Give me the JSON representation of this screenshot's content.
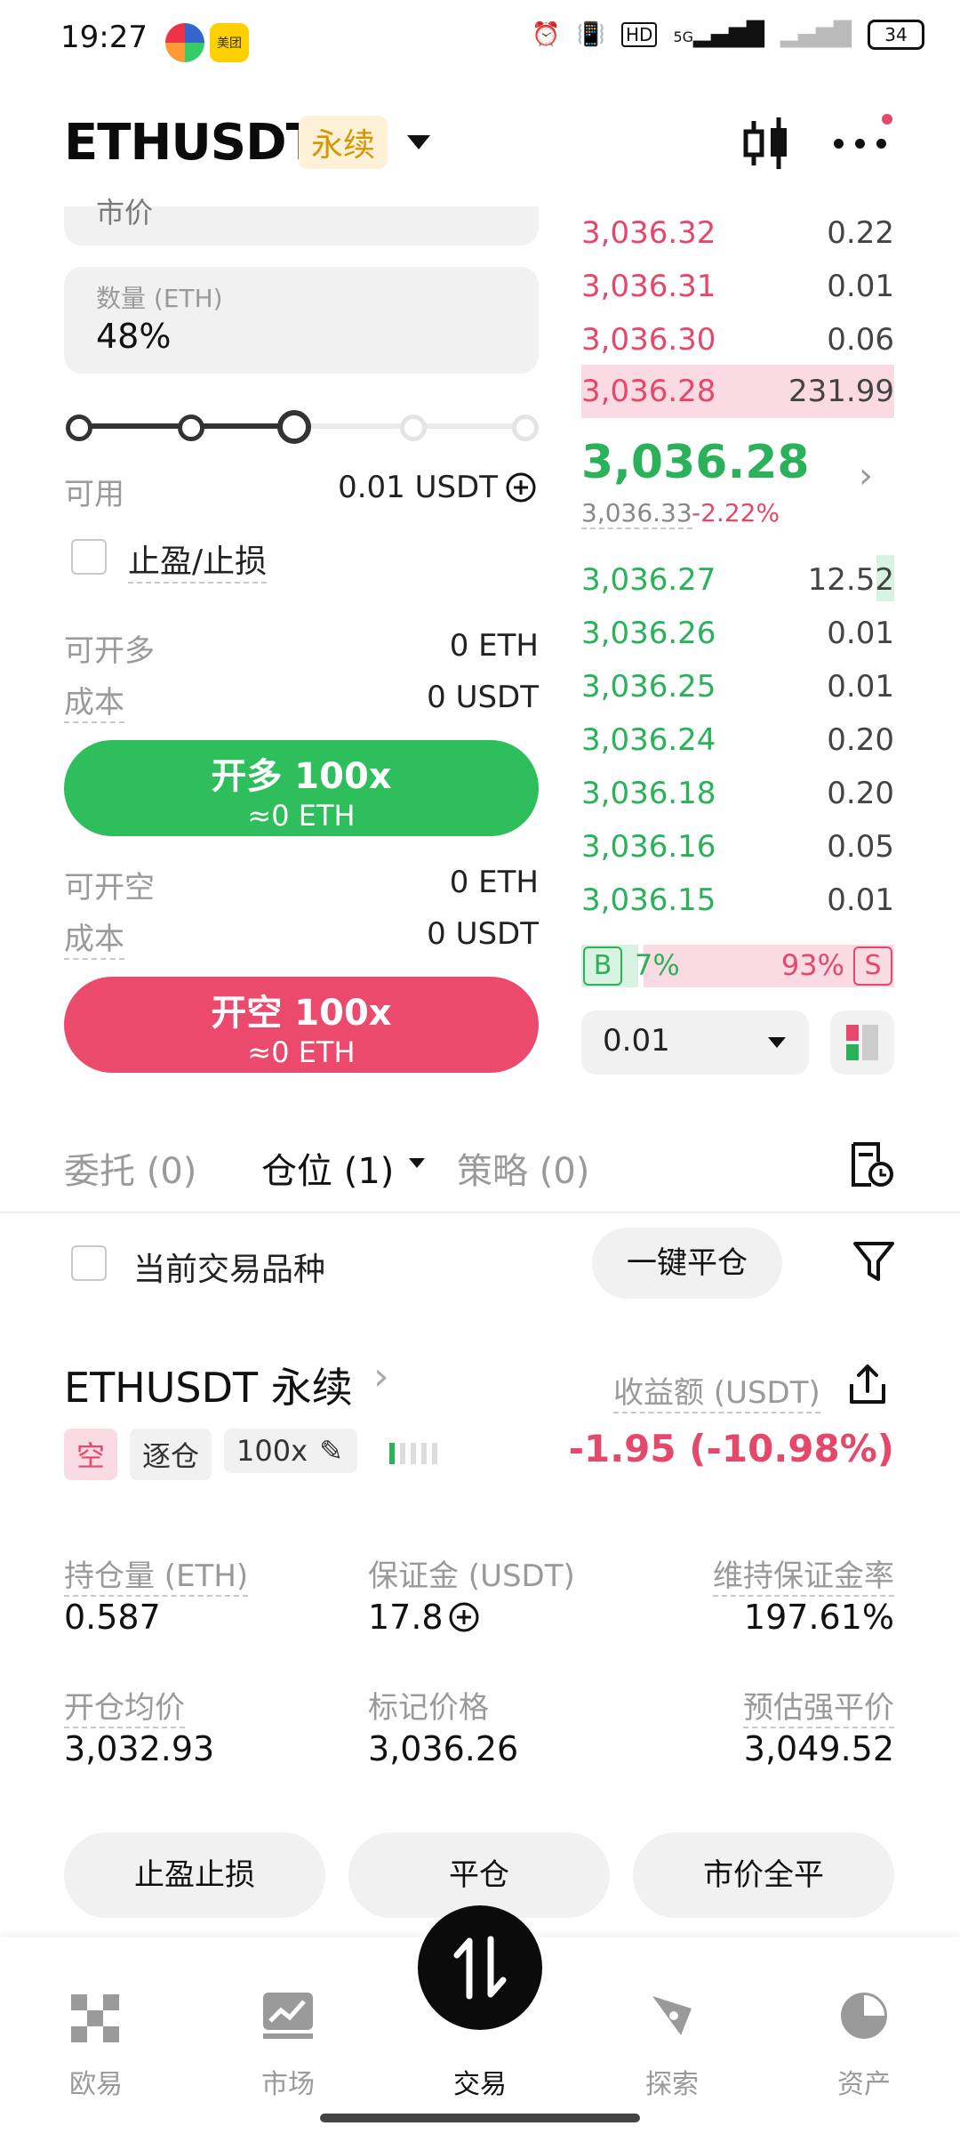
{
  "status_bar": {
    "time": "19:27",
    "network": "5G",
    "battery": "34"
  },
  "header": {
    "symbol": "ETHUSDT",
    "badge": "永续"
  },
  "order_form": {
    "price_field_label": "市价",
    "qty_label": "数量 (ETH)",
    "qty_value": "48%",
    "slider_percent": 48,
    "available_label": "可用",
    "available_value": "0.01 USDT",
    "tpsl_label": "止盈/止损",
    "long_avail_label": "可开多",
    "long_avail_value": "0 ETH",
    "long_cost_label": "成本",
    "long_cost_value": "0 USDT",
    "long_btn_title": "开多 100x",
    "long_btn_sub": "≈0 ETH",
    "short_avail_label": "可开空",
    "short_avail_value": "0 ETH",
    "short_cost_label": "成本",
    "short_cost_value": "0 USDT",
    "short_btn_title": "开空 100x",
    "short_btn_sub": "≈0 ETH"
  },
  "orderbook": {
    "asks": [
      {
        "price": "3,036.32",
        "qty": "0.22"
      },
      {
        "price": "3,036.31",
        "qty": "0.01"
      },
      {
        "price": "3,036.30",
        "qty": "0.06"
      },
      {
        "price": "3,036.28",
        "qty": "231.99"
      }
    ],
    "last_price": "3,036.28",
    "mark_price": "3,036.33",
    "change": "-2.22%",
    "bids": [
      {
        "price": "3,036.27",
        "qty": "12.52"
      },
      {
        "price": "3,036.26",
        "qty": "0.01"
      },
      {
        "price": "3,036.25",
        "qty": "0.01"
      },
      {
        "price": "3,036.24",
        "qty": "0.20"
      },
      {
        "price": "3,036.18",
        "qty": "0.20"
      },
      {
        "price": "3,036.16",
        "qty": "0.05"
      },
      {
        "price": "3,036.15",
        "qty": "0.01"
      }
    ],
    "buy_tag": "B",
    "buy_pct": "7%",
    "sell_pct": "93%",
    "sell_tag": "S",
    "precision": "0.01"
  },
  "tabs": {
    "orders": "委托 (0)",
    "positions": "仓位 (1)",
    "strategies": "策略 (0)"
  },
  "filter": {
    "current_symbol_label": "当前交易品种",
    "close_all": "一键平仓"
  },
  "position": {
    "name": "ETHUSDT 永续",
    "pnl_label": "收益额 (USDT)",
    "side": "空",
    "margin_mode": "逐仓",
    "leverage": "100x",
    "pnl_value": "-1.95 (-10.98%)",
    "size_label": "持仓量 (ETH)",
    "size_value": "0.587",
    "margin_label": "保证金 (USDT)",
    "margin_value": "17.8",
    "mmr_label": "维持保证金率",
    "mmr_value": "197.61%",
    "entry_label": "开仓均价",
    "entry_value": "3,032.93",
    "mark_label": "标记价格",
    "mark_value": "3,036.26",
    "liq_label": "预估强平价",
    "liq_value": "3,049.52"
  },
  "actions": {
    "tpsl": "止盈止损",
    "close": "平仓",
    "market_close": "市价全平"
  },
  "bottom_nav": {
    "home": "欧易",
    "market": "市场",
    "trade": "交易",
    "explore": "探索",
    "assets": "资产"
  },
  "colors": {
    "green": "#2ab15a",
    "red": "#e4486b",
    "badge_bg": "#fff1d8",
    "badge_fg": "#d59600"
  }
}
